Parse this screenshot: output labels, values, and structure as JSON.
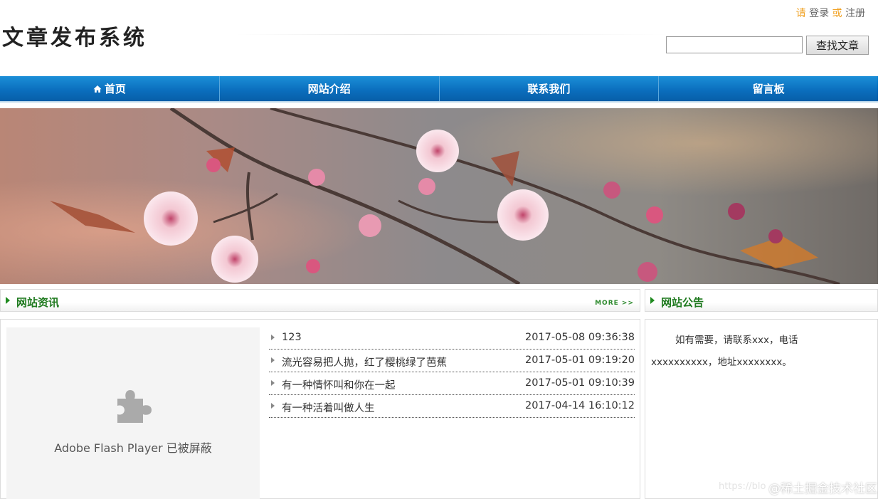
{
  "header": {
    "site_title": "文章发布系统",
    "auth_prefix": "请",
    "login_label": "登录",
    "auth_or": "或",
    "register_label": "注册",
    "search_value": "",
    "search_button": "查找文章"
  },
  "nav": {
    "items": [
      {
        "label": "首页",
        "icon": "home-icon"
      },
      {
        "label": "网站介绍"
      },
      {
        "label": "联系我们"
      },
      {
        "label": "留言板"
      }
    ]
  },
  "news": {
    "title": "网站资讯",
    "more_label": "MORE >>",
    "flash_message": "Adobe Flash Player 已被屏蔽",
    "items": [
      {
        "title": "123",
        "date": "2017-05-08 09:36:38"
      },
      {
        "title": "流光容易把人抛，红了樱桃绿了芭蕉",
        "date": "2017-05-01 09:19:20"
      },
      {
        "title": "有一种情怀叫和你在一起",
        "date": "2017-05-01 09:10:39"
      },
      {
        "title": "有一种活着叫做人生",
        "date": "2017-04-14 16:10:12"
      }
    ]
  },
  "notice": {
    "title": "网站公告",
    "text": "如有需要，请联系xxx，电话xxxxxxxxxx，地址xxxxxxxx。"
  },
  "watermark": {
    "url": "https://blo",
    "text": "@稀土掘金技术社区"
  },
  "colors": {
    "nav_blue": "#0b6fbe",
    "heading_green": "#1f7a1f",
    "accent_orange": "#f0a020"
  }
}
